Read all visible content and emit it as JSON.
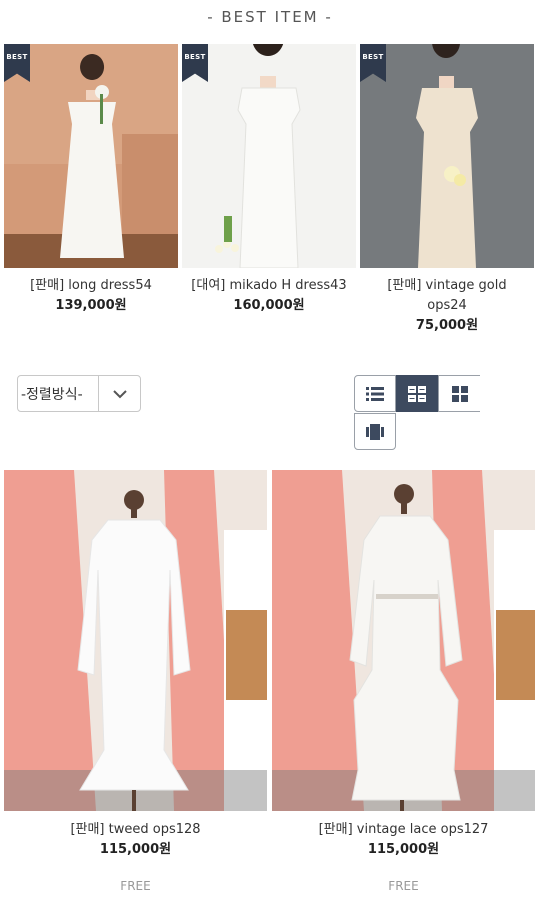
{
  "best_section": {
    "title": "- BEST ITEM -",
    "badge": "BEST",
    "items": [
      {
        "name": "[판매] long dress54",
        "price": "139,000원"
      },
      {
        "name": "[대여] mikado H dress43",
        "price": "160,000원"
      },
      {
        "name": "[판매] vintage gold ops24",
        "price": "75,000원"
      }
    ]
  },
  "toolbar": {
    "sort_label": "-정렬방식-",
    "view_modes": [
      "list",
      "grid-2",
      "grid-3",
      "gallery"
    ],
    "active_view": "grid-2"
  },
  "products": [
    {
      "name": "[판매] tweed ops128",
      "price": "115,000원",
      "shipping": "FREE"
    },
    {
      "name": "[판매] vintage lace ops127",
      "price": "115,000원",
      "shipping": "FREE"
    }
  ],
  "colors": {
    "accent": "#3d4a5f",
    "badge": "#2f3a4d",
    "muted": "#999999"
  }
}
